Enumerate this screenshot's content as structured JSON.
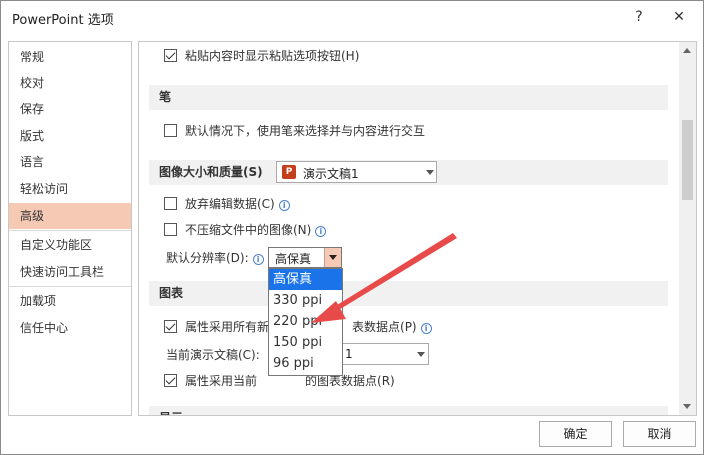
{
  "window": {
    "title": "PowerPoint 选项",
    "help_glyph": "?",
    "close_glyph": "✕"
  },
  "sidebar": {
    "items": [
      {
        "label": "常规"
      },
      {
        "label": "校对"
      },
      {
        "label": "保存"
      },
      {
        "label": "版式"
      },
      {
        "label": "语言"
      },
      {
        "label": "轻松访问"
      },
      {
        "label": "高级"
      },
      {
        "label": "自定义功能区"
      },
      {
        "label": "快速访问工具栏"
      },
      {
        "label": "加载项"
      },
      {
        "label": "信任中心"
      }
    ],
    "active": "高级"
  },
  "content": {
    "paste_option": "粘贴内容时显示粘贴选项按钮(H)",
    "pen_section": "笔",
    "pen_option": "默认情况下，使用笔来选择并与内容进行交互",
    "image_section": "图像大小和质量(S)",
    "image_doc_select": "演示文稿1",
    "discard_edit_data": "放弃编辑数据(C)",
    "no_compress": "不压缩文件中的图像(N)",
    "default_res_label": "默认分辨率(D):",
    "default_res_value": "高保真",
    "res_options": [
      "高保真",
      "330 ppi",
      "220 ppi",
      "150 ppi",
      "96 ppi"
    ],
    "chart_section": "图表",
    "chart_prop_all_pre": "属性采用所有新",
    "chart_prop_all_post": "表数据点(P)",
    "current_doc_label": "当前演示文稿(C):",
    "current_doc_value": "1",
    "chart_prop_current_pre": "属性采用当前",
    "chart_prop_current_post": "的图表数据点(R)",
    "display_section": "显示"
  },
  "checkbox_states": {
    "paste_option": true,
    "pen_option": false,
    "discard_edit_data": false,
    "no_compress": false,
    "chart_prop_all": true,
    "chart_prop_current": true
  },
  "footer": {
    "ok": "确定",
    "cancel": "取消"
  },
  "colors": {
    "active_nav": "#f6c9b5",
    "dropdown_selected": "#1a73e8",
    "annotation_arrow": "#e84a4a"
  },
  "icons": {
    "info": "info-icon",
    "ppt": "powerpoint-icon",
    "checkbox": "checkbox-icon"
  }
}
